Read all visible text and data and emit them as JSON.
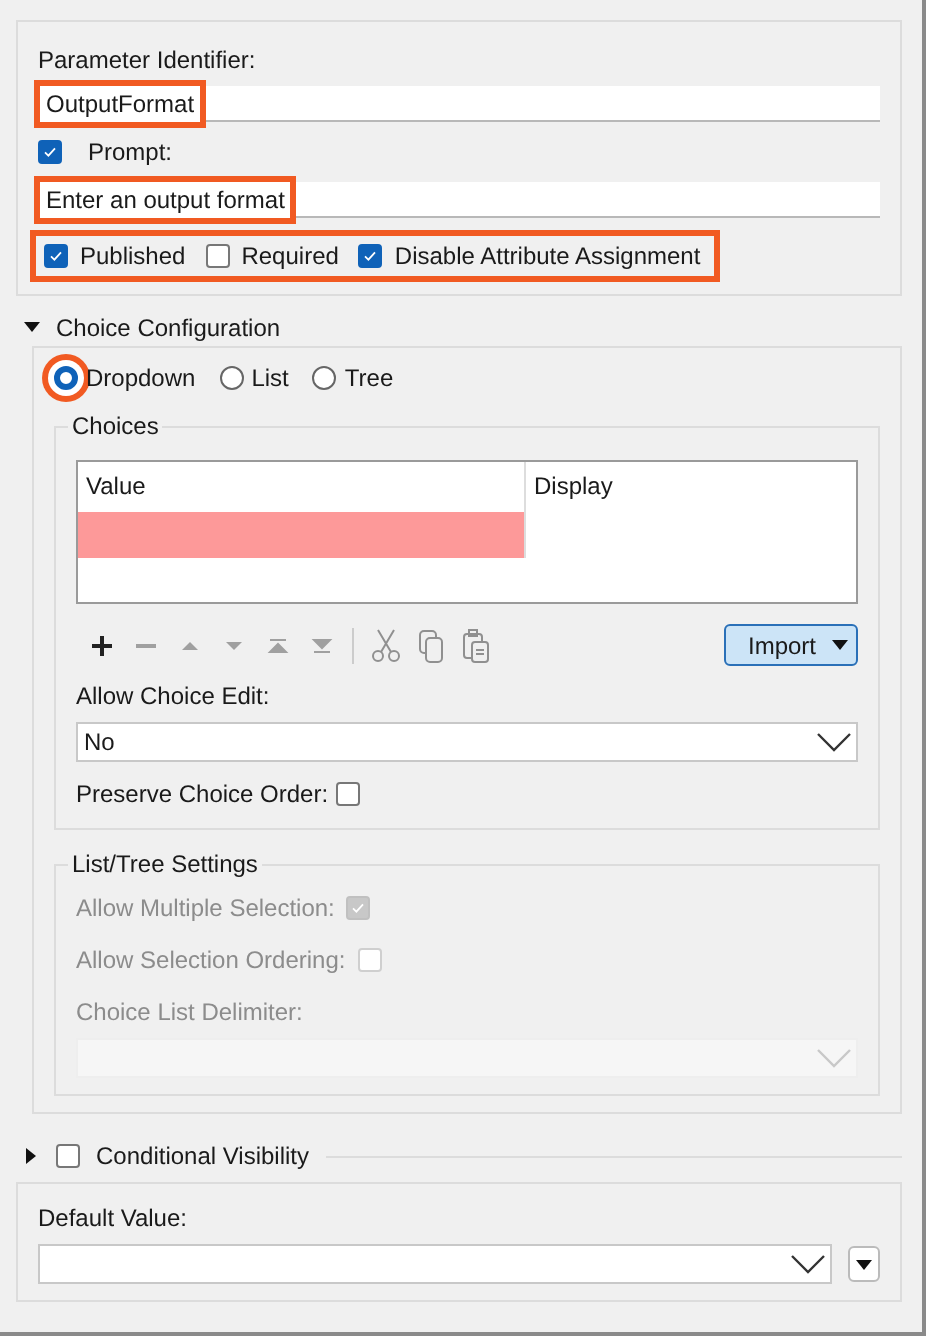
{
  "identifier": {
    "label": "Parameter Identifier:",
    "value": "OutputFormat",
    "highlighted": true
  },
  "prompt": {
    "label": "Prompt:",
    "checked": true,
    "value": "Enter an output format",
    "highlighted": true
  },
  "flags": {
    "highlighted": true,
    "items": [
      {
        "label": "Published",
        "checked": true
      },
      {
        "label": "Required",
        "checked": false
      },
      {
        "label": "Disable Attribute Assignment",
        "checked": true
      }
    ]
  },
  "choice_configuration": {
    "title": "Choice Configuration",
    "expanded": true,
    "modes": [
      {
        "label": "Dropdown",
        "selected": true,
        "highlighted": true
      },
      {
        "label": "List",
        "selected": false,
        "highlighted": false
      },
      {
        "label": "Tree",
        "selected": false,
        "highlighted": false
      }
    ],
    "choices": {
      "title": "Choices",
      "columns": [
        "Value",
        "Display"
      ],
      "rows": [
        {
          "invalid": true
        }
      ],
      "toolbar": [
        {
          "kind": "add",
          "disabled": false
        },
        {
          "kind": "remove",
          "disabled": true
        },
        {
          "kind": "up",
          "disabled": true
        },
        {
          "kind": "down",
          "disabled": true
        },
        {
          "kind": "top",
          "disabled": true
        },
        {
          "kind": "bottom",
          "disabled": true
        },
        {
          "kind": "separator",
          "disabled": true
        },
        {
          "kind": "cut",
          "disabled": true
        },
        {
          "kind": "copy",
          "disabled": true
        },
        {
          "kind": "paste",
          "disabled": true
        }
      ],
      "import_button": "Import",
      "allow_edit": {
        "label": "Allow Choice Edit:",
        "value": "No"
      },
      "preserve_order": {
        "label": "Preserve Choice Order:",
        "checked": false
      }
    },
    "list_tree": {
      "title": "List/Tree Settings",
      "disabled": true,
      "options": [
        {
          "label": "Allow Multiple Selection:",
          "checked": true
        },
        {
          "label": "Allow Selection Ordering:",
          "checked": false
        }
      ],
      "delimiter_label": "Choice List Delimiter:"
    }
  },
  "conditional_visibility": {
    "label": "Conditional Visibility",
    "expanded": false,
    "checked": false
  },
  "default_value": {
    "label": "Default Value:"
  }
}
